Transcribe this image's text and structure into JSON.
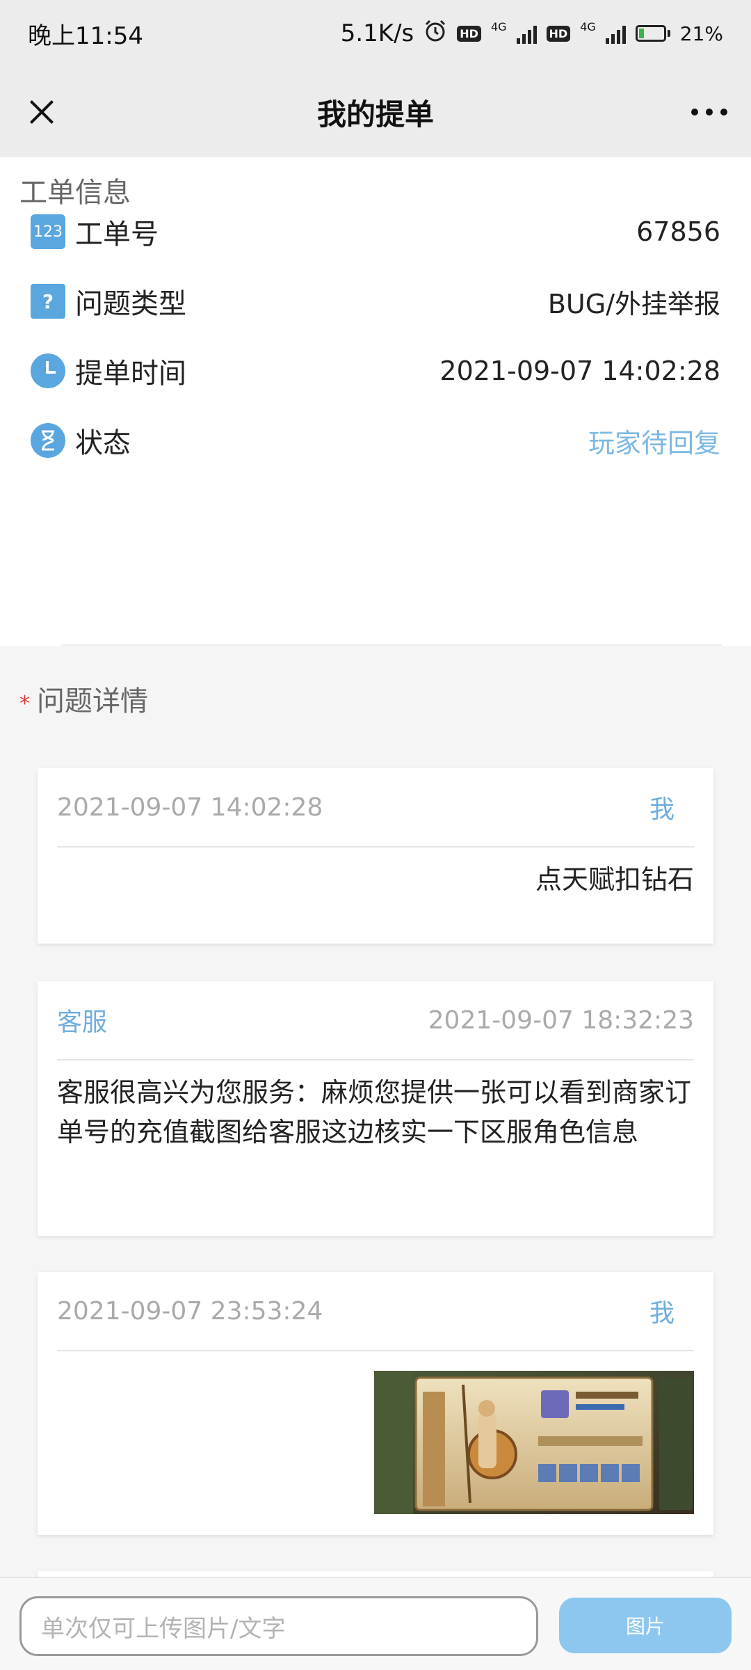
{
  "status_bar": {
    "time": "晚上11:54",
    "speed": "5.1K/s",
    "network": "4G",
    "battery": "21%",
    "battery_level": 0.21
  },
  "nav": {
    "title": "我的提单",
    "close_icon": "close-icon",
    "more_icon": "more-dots-icon"
  },
  "info": {
    "section_title": "工单信息",
    "rows": [
      {
        "icon": "123",
        "label": "工单号",
        "value": "67856"
      },
      {
        "icon": "?",
        "label": "问题类型",
        "value": "BUG/外挂举报"
      },
      {
        "icon": "clock",
        "label": "提单时间",
        "value": "2021-09-07 14:02:28"
      },
      {
        "icon": "hourglass",
        "label": "状态",
        "value": "玩家待回复"
      }
    ],
    "status_color": "#7cb8e2"
  },
  "detail": {
    "required_mark": "*",
    "section_title": "问题详情",
    "messages": [
      {
        "time": "2021-09-07 14:02:28",
        "sender": "我",
        "text": "点天赋扣钻石"
      },
      {
        "time": "2021-09-07 18:32:23",
        "sender": "客服",
        "text": "客服很高兴为您服务：麻烦您提供一张可以看到商家订单号的充值截图给客服这边核实一下区服角色信息"
      },
      {
        "time": "2021-09-07 23:53:24",
        "sender": "我",
        "image": "game-screenshot"
      }
    ]
  },
  "composer": {
    "placeholder": "单次仅可上传图片/文字",
    "button_label": "图片"
  },
  "colors": {
    "accent": "#6faedc",
    "button": "#8dc7f0",
    "required": "#e23b3b"
  }
}
